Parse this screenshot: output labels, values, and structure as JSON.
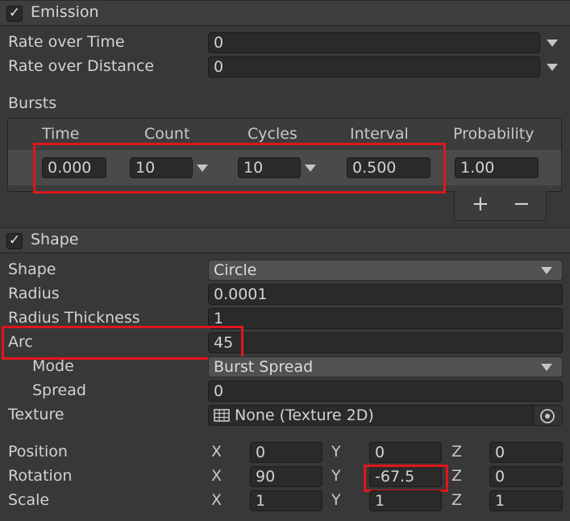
{
  "emission": {
    "title": "Emission",
    "rate_over_time": {
      "label": "Rate over Time",
      "value": "0"
    },
    "rate_over_distance": {
      "label": "Rate over Distance",
      "value": "0"
    },
    "bursts": {
      "label": "Bursts",
      "columns": [
        "Time",
        "Count",
        "Cycles",
        "Interval",
        "Probability"
      ],
      "row": {
        "time": "0.000",
        "count": "10",
        "cycles": "10",
        "interval": "0.500",
        "probability": "1.00"
      },
      "add_symbol": "+",
      "remove_symbol": "−"
    }
  },
  "shape": {
    "title": "Shape",
    "shape": {
      "label": "Shape",
      "value": "Circle"
    },
    "radius": {
      "label": "Radius",
      "value": "0.0001"
    },
    "radius_thickness": {
      "label": "Radius Thickness",
      "value": "1"
    },
    "arc": {
      "label": "Arc",
      "value": "45"
    },
    "mode": {
      "label": "Mode",
      "value": "Burst Spread"
    },
    "spread": {
      "label": "Spread",
      "value": "0"
    },
    "texture": {
      "label": "Texture",
      "value": "None (Texture 2D)",
      "icon": "texture-icon"
    },
    "position": {
      "label": "Position",
      "x": "0",
      "y": "0",
      "z": "0"
    },
    "rotation": {
      "label": "Rotation",
      "x": "90",
      "y": "-67.5",
      "z": "0"
    },
    "scale": {
      "label": "Scale",
      "x": "1",
      "y": "1",
      "z": "1"
    },
    "axes": {
      "x": "X",
      "y": "Y",
      "z": "Z"
    }
  },
  "check_mark": "✓",
  "colors": {
    "highlight": "#e0161b",
    "background": "#383838",
    "field": "#2a2a2a"
  }
}
